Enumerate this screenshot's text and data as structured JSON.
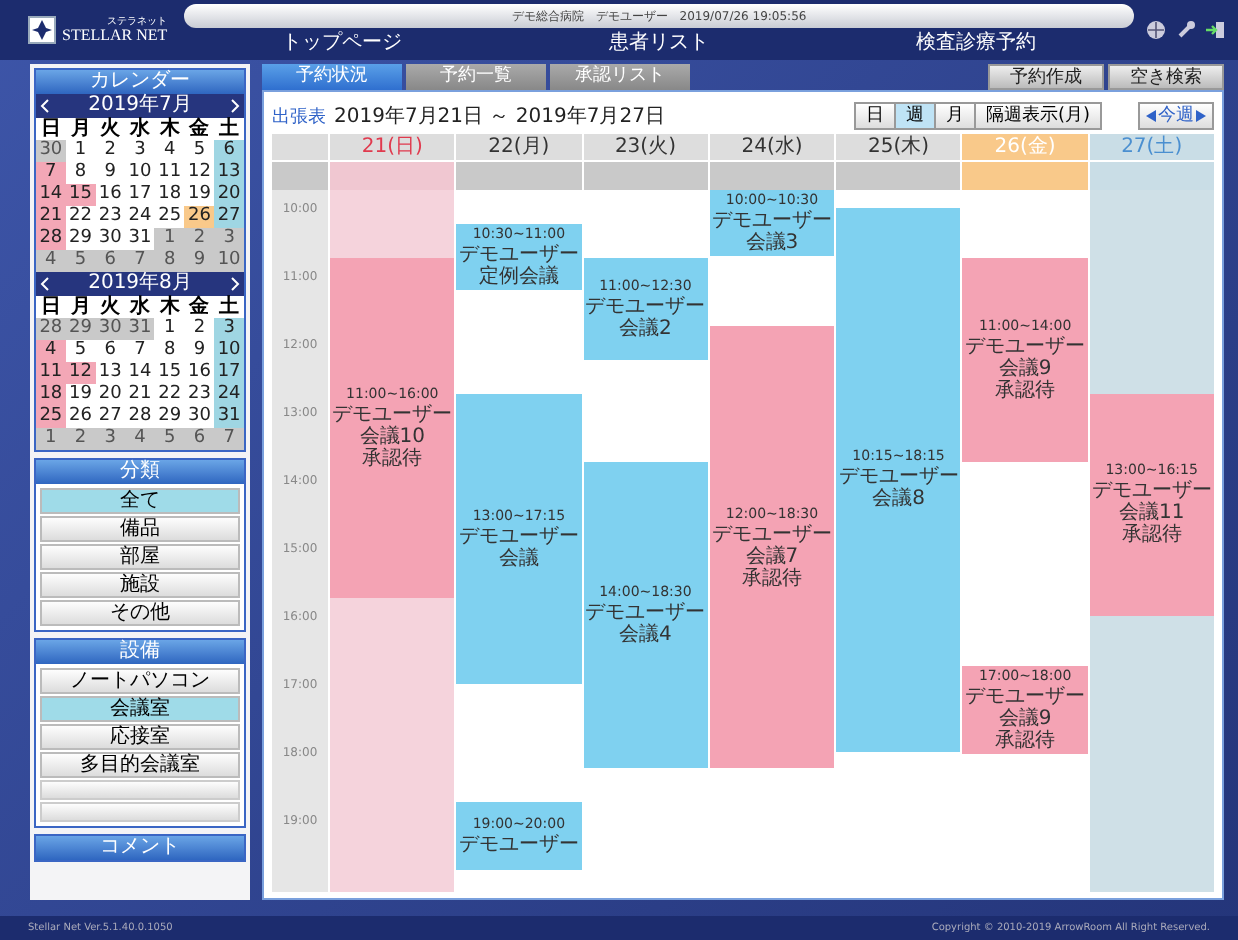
{
  "header": {
    "logo_kana": "ステラネット",
    "logo_name": "STELLAR NET",
    "status": "デモ総合病院　デモユーザー　2019/07/26 19:05:56",
    "nav": [
      "トップページ",
      "患者リスト",
      "検査診療予約"
    ]
  },
  "sidebar": {
    "calendar_title": "カレンダー",
    "months": [
      {
        "title": "2019年7月",
        "weekdays": [
          "日",
          "月",
          "火",
          "水",
          "木",
          "金",
          "土"
        ],
        "weeks": [
          [
            {
              "day": "30",
              "kind": "other"
            },
            {
              "day": "1",
              "kind": "normal"
            },
            {
              "day": "2",
              "kind": "normal"
            },
            {
              "day": "3",
              "kind": "normal"
            },
            {
              "day": "4",
              "kind": "normal"
            },
            {
              "day": "5",
              "kind": "normal"
            },
            {
              "day": "6",
              "kind": "saturday"
            }
          ],
          [
            {
              "day": "7",
              "kind": "holiday"
            },
            {
              "day": "8",
              "kind": "normal"
            },
            {
              "day": "9",
              "kind": "normal"
            },
            {
              "day": "10",
              "kind": "normal"
            },
            {
              "day": "11",
              "kind": "normal"
            },
            {
              "day": "12",
              "kind": "normal"
            },
            {
              "day": "13",
              "kind": "saturday"
            }
          ],
          [
            {
              "day": "14",
              "kind": "holiday"
            },
            {
              "day": "15",
              "kind": "holiday"
            },
            {
              "day": "16",
              "kind": "normal"
            },
            {
              "day": "17",
              "kind": "normal"
            },
            {
              "day": "18",
              "kind": "normal"
            },
            {
              "day": "19",
              "kind": "normal"
            },
            {
              "day": "20",
              "kind": "saturday"
            }
          ],
          [
            {
              "day": "21",
              "kind": "holiday"
            },
            {
              "day": "22",
              "kind": "normal"
            },
            {
              "day": "23",
              "kind": "normal"
            },
            {
              "day": "24",
              "kind": "normal"
            },
            {
              "day": "25",
              "kind": "normal"
            },
            {
              "day": "26",
              "kind": "today"
            },
            {
              "day": "27",
              "kind": "saturday"
            }
          ],
          [
            {
              "day": "28",
              "kind": "holiday"
            },
            {
              "day": "29",
              "kind": "normal"
            },
            {
              "day": "30",
              "kind": "normal"
            },
            {
              "day": "31",
              "kind": "normal"
            },
            {
              "day": "1",
              "kind": "other"
            },
            {
              "day": "2",
              "kind": "other"
            },
            {
              "day": "3",
              "kind": "other"
            }
          ],
          [
            {
              "day": "4",
              "kind": "other"
            },
            {
              "day": "5",
              "kind": "other"
            },
            {
              "day": "6",
              "kind": "other"
            },
            {
              "day": "7",
              "kind": "other"
            },
            {
              "day": "8",
              "kind": "other"
            },
            {
              "day": "9",
              "kind": "other"
            },
            {
              "day": "10",
              "kind": "other"
            }
          ]
        ]
      },
      {
        "title": "2019年8月",
        "weekdays": [
          "日",
          "月",
          "火",
          "水",
          "木",
          "金",
          "土"
        ],
        "weeks": [
          [
            {
              "day": "28",
              "kind": "other"
            },
            {
              "day": "29",
              "kind": "other"
            },
            {
              "day": "30",
              "kind": "other"
            },
            {
              "day": "31",
              "kind": "other"
            },
            {
              "day": "1",
              "kind": "normal"
            },
            {
              "day": "2",
              "kind": "normal"
            },
            {
              "day": "3",
              "kind": "saturday"
            }
          ],
          [
            {
              "day": "4",
              "kind": "holiday"
            },
            {
              "day": "5",
              "kind": "normal"
            },
            {
              "day": "6",
              "kind": "normal"
            },
            {
              "day": "7",
              "kind": "normal"
            },
            {
              "day": "8",
              "kind": "normal"
            },
            {
              "day": "9",
              "kind": "normal"
            },
            {
              "day": "10",
              "kind": "saturday"
            }
          ],
          [
            {
              "day": "11",
              "kind": "holiday"
            },
            {
              "day": "12",
              "kind": "holiday"
            },
            {
              "day": "13",
              "kind": "normal"
            },
            {
              "day": "14",
              "kind": "normal"
            },
            {
              "day": "15",
              "kind": "normal"
            },
            {
              "day": "16",
              "kind": "normal"
            },
            {
              "day": "17",
              "kind": "saturday"
            }
          ],
          [
            {
              "day": "18",
              "kind": "holiday"
            },
            {
              "day": "19",
              "kind": "normal"
            },
            {
              "day": "20",
              "kind": "normal"
            },
            {
              "day": "21",
              "kind": "normal"
            },
            {
              "day": "22",
              "kind": "normal"
            },
            {
              "day": "23",
              "kind": "normal"
            },
            {
              "day": "24",
              "kind": "saturday"
            }
          ],
          [
            {
              "day": "25",
              "kind": "holiday"
            },
            {
              "day": "26",
              "kind": "normal"
            },
            {
              "day": "27",
              "kind": "normal"
            },
            {
              "day": "28",
              "kind": "normal"
            },
            {
              "day": "29",
              "kind": "normal"
            },
            {
              "day": "30",
              "kind": "normal"
            },
            {
              "day": "31",
              "kind": "saturday"
            }
          ],
          [
            {
              "day": "1",
              "kind": "other"
            },
            {
              "day": "2",
              "kind": "other"
            },
            {
              "day": "3",
              "kind": "other"
            },
            {
              "day": "4",
              "kind": "other"
            },
            {
              "day": "5",
              "kind": "other"
            },
            {
              "day": "6",
              "kind": "other"
            },
            {
              "day": "7",
              "kind": "other"
            }
          ]
        ]
      }
    ],
    "category_title": "分類",
    "categories": [
      {
        "label": "全て",
        "selected": true
      },
      {
        "label": "備品",
        "selected": false
      },
      {
        "label": "部屋",
        "selected": false
      },
      {
        "label": "施設",
        "selected": false
      },
      {
        "label": "その他",
        "selected": false
      }
    ],
    "equipment_title": "設備",
    "equipment": [
      {
        "label": "ノートパソコン",
        "selected": false
      },
      {
        "label": "会議室",
        "selected": true
      },
      {
        "label": "応接室",
        "selected": false
      },
      {
        "label": "多目的会議室",
        "selected": false
      }
    ],
    "comment_title": "コメント"
  },
  "tabs": [
    {
      "label": "予約状況",
      "selected": true
    },
    {
      "label": "予約一覧",
      "selected": false
    },
    {
      "label": "承認リスト",
      "selected": false
    }
  ],
  "actions": [
    "予約作成",
    "空き検索"
  ],
  "toolbar": {
    "link": "出張表",
    "range": "2019年7月21日 ～ 2019年7月27日",
    "views": [
      {
        "label": "日",
        "selected": false
      },
      {
        "label": "週",
        "selected": true
      },
      {
        "label": "月",
        "selected": false
      },
      {
        "label": "隔週表示(月)",
        "selected": false
      }
    ],
    "this_week": "今週"
  },
  "hours": [
    "10:00",
    "11:00",
    "12:00",
    "13:00",
    "14:00",
    "15:00",
    "16:00",
    "17:00",
    "18:00",
    "19:00"
  ],
  "days": [
    {
      "label": "21(日)",
      "kind": "sunday",
      "events": [
        {
          "time": "11:00~16:00",
          "user": "デモユーザー",
          "title": "会議10",
          "status": "承認待"
        }
      ]
    },
    {
      "label": "22(月)",
      "kind": "weekday",
      "events": [
        {
          "time": "10:30~11:00",
          "user": "デモユーザー",
          "title": "定例会議"
        },
        {
          "time": "13:00~17:15",
          "user": "デモユーザー",
          "title": "会議"
        },
        {
          "time": "19:00~20:00",
          "user": "デモユーザー"
        }
      ]
    },
    {
      "label": "23(火)",
      "kind": "weekday",
      "events": [
        {
          "time": "11:00~12:30",
          "user": "デモユーザー",
          "title": "会議2"
        },
        {
          "time": "14:00~18:30",
          "user": "デモユーザー",
          "title": "会議4"
        }
      ]
    },
    {
      "label": "24(水)",
      "kind": "weekday",
      "events": [
        {
          "time": "10:00~10:30",
          "user": "デモユーザー",
          "title": "会議3"
        },
        {
          "time": "12:00~18:30",
          "user": "デモユーザー",
          "title": "会議7",
          "status": "承認待"
        }
      ]
    },
    {
      "label": "25(木)",
      "kind": "weekday",
      "events": [
        {
          "time": "10:15~18:15",
          "user": "デモユーザー",
          "title": "会議8"
        }
      ]
    },
    {
      "label": "26(金)",
      "kind": "today",
      "events": [
        {
          "time": "11:00~14:00",
          "user": "デモユーザー",
          "title": "会議9",
          "status": "承認待"
        },
        {
          "time": "17:00~18:00",
          "user": "デモユーザー",
          "title": "会議9",
          "status": "承認待"
        }
      ]
    },
    {
      "label": "27(土)",
      "kind": "saturday",
      "events": [
        {
          "time": "13:00~16:15",
          "user": "デモユーザー",
          "title": "会議11",
          "status": "承認待"
        }
      ]
    }
  ],
  "footer": {
    "version": "Stellar Net Ver.5.1.40.0.1050",
    "copyright": "Copyright © 2010-2019 ArrowRoom All Right Reserved."
  }
}
